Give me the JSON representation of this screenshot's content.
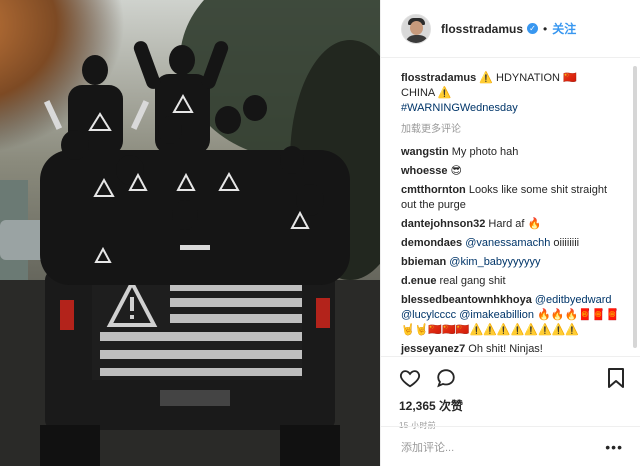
{
  "header": {
    "username": "flosstradamus",
    "separator": "•",
    "follow_label": "关注"
  },
  "caption": {
    "username": "flosstradamus",
    "text_a": "⚠️ HDYNATION 🇨🇳",
    "text_b": "CHINA ⚠️",
    "hashtag": "#WARNINGWednesday"
  },
  "load_more": "加载更多评论",
  "comments": [
    {
      "user": "wangstin",
      "text": "My photo hah"
    },
    {
      "user": "whoesse",
      "text": "😎"
    },
    {
      "user": "cmtthornton",
      "text": "Looks like some shit straight out the purge"
    },
    {
      "user": "dantejohnson32",
      "text": "Hard af 🔥"
    },
    {
      "user": "demondaes",
      "mention": "@vanessamachh",
      "text": "oiiiiiiii"
    },
    {
      "user": "bbieman",
      "mention": "@kim_babyyyyyyy",
      "text": ""
    },
    {
      "user": "d.enue",
      "text": "real gang shit"
    },
    {
      "user": "blessedbeantownhkhoya",
      "mention": "@editbyedward",
      "mention2": "@lucylcccc",
      "mention3": "@imakeabillion",
      "text": "🔥🔥🔥🧧🧧🧧🤘🤘🇨🇳🇨🇳🇨🇳⚠️⚠️⚠️⚠️⚠️⚠️⚠️⚠️"
    },
    {
      "user": "jesseyanez7",
      "text": "Oh shit! Ninjas!"
    }
  ],
  "likes": "12,365 次赞",
  "time": "15 小时前",
  "add_comment_placeholder": "添加评论...",
  "more_label": "•••",
  "colors": {
    "link": "#003569",
    "accent": "#3897f0",
    "muted": "#999999"
  },
  "icons": {
    "like": "heart-icon",
    "comment": "comment-bubble-icon",
    "save": "bookmark-icon",
    "verified": "verified-badge-icon",
    "more": "more-options-icon"
  }
}
